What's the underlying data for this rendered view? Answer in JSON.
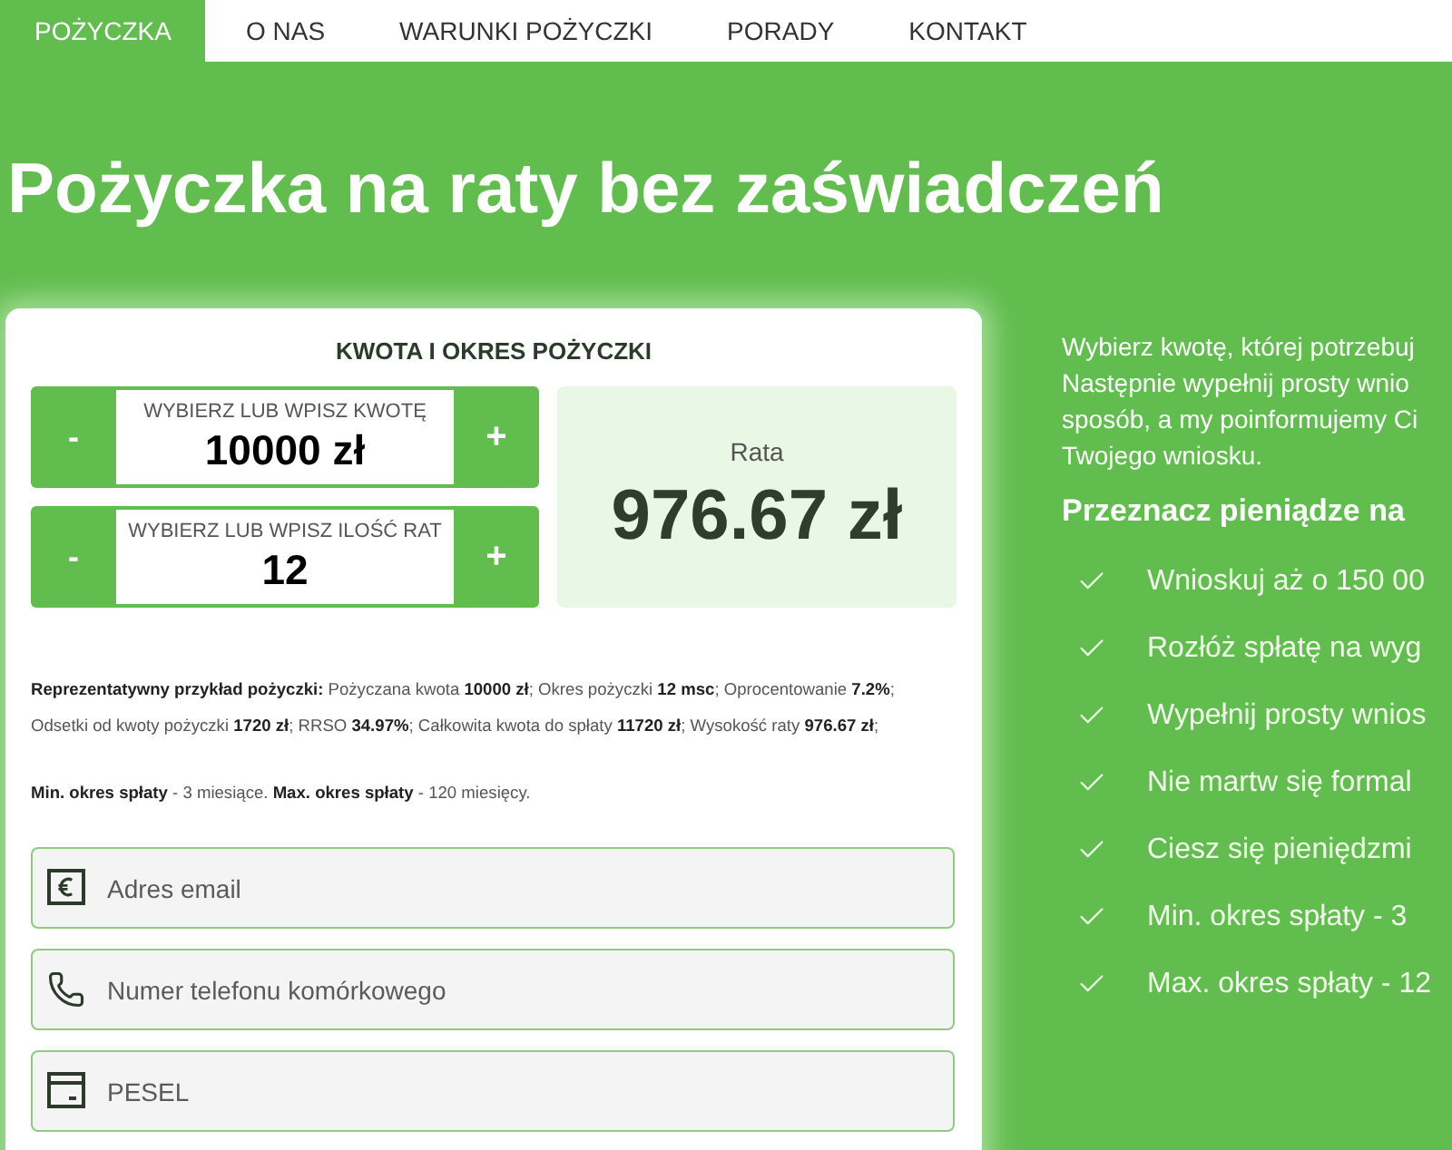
{
  "nav": {
    "items": [
      {
        "label": "POŻYCZKA",
        "selected": true
      },
      {
        "label": "O NAS",
        "selected": false
      },
      {
        "label": "WARUNKI POŻYCZKI",
        "selected": false
      },
      {
        "label": "PORADY",
        "selected": false
      },
      {
        "label": "KONTAKT",
        "selected": false
      }
    ]
  },
  "hero": {
    "title": "Pożyczka na raty bez zaświadczeń"
  },
  "calculator": {
    "title": "KWOTA I OKRES POŻYCZKI",
    "steppers": [
      {
        "label": "WYBIERZ LUB WPISZ KWOTĘ",
        "value": "10000 zł",
        "decrement": "-",
        "increment": "+"
      },
      {
        "label": "WYBIERZ LUB WPISZ ILOŚĆ RAT",
        "value": "12",
        "decrement": "-",
        "increment": "+"
      }
    ],
    "result": {
      "label": "Rata",
      "value": "976.67 zł"
    },
    "example": "**Reprezentatywny przykład pożyczki:** Pożyczana kwota **10000 zł**; Okres pożyczki **12 msc**; Oprocentowanie **7.2%**; Odsetki od kwoty pożyczki **1720 zł**; RRSO **34.97%**; Całkowita kwota do spłaty **11720 zł**; Wysokość raty **976.67 zł**;",
    "terms": "**Min. okres spłaty** - 3 miesiące. **Max. okres spłaty** - 120 miesięcy.",
    "fields": [
      {
        "kind": "email",
        "placeholder": "Adres email"
      },
      {
        "kind": "phone",
        "placeholder": "Numer telefonu komórkowego"
      },
      {
        "kind": "id",
        "placeholder": "PESEL"
      }
    ]
  },
  "info": {
    "intro_lines": [
      "Wybierz kwotę, której potrzebuj",
      "Następnie wypełnij prosty wnio",
      "sposób, a my poinformujemy Ci",
      "Twojego wniosku."
    ],
    "heading": "Przeznacz pieniądze na",
    "benefits": [
      "Wnioskuj aż o 150 00",
      "Rozłóż spłatę na wyg",
      "Wypełnij prosty wnios",
      "Nie martw się formal",
      "Ciesz się pieniędzmi",
      "Min. okres spłaty - 3",
      "Max. okres spłaty - 12"
    ]
  }
}
